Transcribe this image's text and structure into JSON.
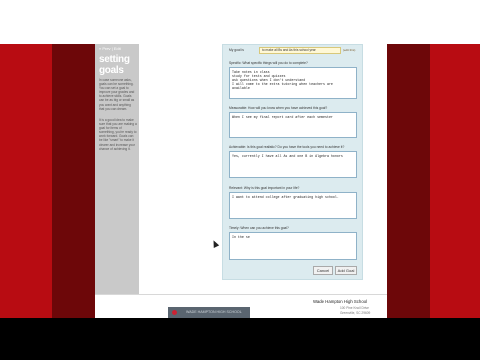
{
  "sidebar": {
    "crumb": "« Prev | Edit",
    "title_line1": "setting",
    "title_line2": "goals",
    "paragraph1": "In case someone asks, goals can be something. You can set a goal to improve your grades and to achieve skills. Goals can be as big or small as you want and anything that you can dream.",
    "paragraph2": "It is a good idea to make sure that you are making a goal for items of something, you're ready to work forward. Goals can be like \"smart\" to make it clearer and increase your chance of achieving it."
  },
  "form": {
    "goal_label": "My goal is",
    "goal_value": "to make all Bs and As this school year",
    "edit_link": "(edit this)",
    "specific_label": "Specific: What specific things will you do to complete?",
    "specific_value": "Take notes in class\nstudy for tests and quizzes\nask questions when I don't understand\nI will come to the extra tutoring when teachers are\navailable",
    "measurable_label": "Measurable: How will you know when you have achieved this goal?",
    "measurable_value": "When I see my final report card after each semester",
    "achievable_label": "Achievable: Is this goal realistic? Do you have the tools you need to achieve it?",
    "achievable_value": "Yes, currently I have all As and one B in Algebra honors",
    "relevant_label": "Relevant: Why is this goal important in your life?",
    "relevant_value": "I want to attend college after graduating high school.",
    "timely_label": "Timely: When can you achieve this goal?",
    "timely_value": "In the se",
    "cancel_label": "Cancel",
    "add_goal_label": "Add Goal"
  },
  "footer": {
    "school": "Wade Hampton High School",
    "addr1": "100 Pine Knoll Drive",
    "addr2": "Greenville, SC 29609",
    "banner_text": "WADE HAMPTON HIGH SCHOOL"
  },
  "colors": {
    "red": "#b80c12",
    "dark_red": "#6d0709",
    "form_bg": "#dcebef"
  }
}
